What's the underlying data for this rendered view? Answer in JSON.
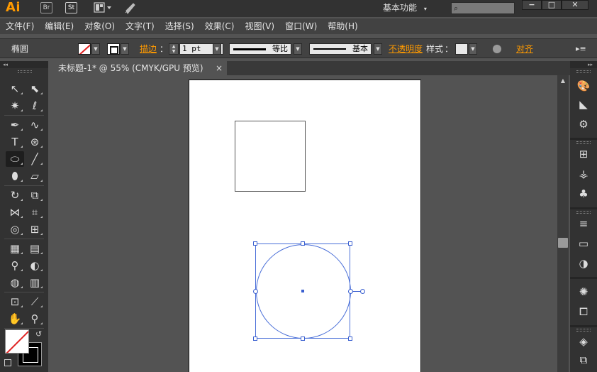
{
  "titlebar": {
    "logo": "Ai",
    "bridge_label": "Br",
    "stock_label": "St",
    "layout_icon": "layout-grid-icon",
    "sync_icon": "rocket-icon",
    "workspace": "基本功能",
    "search_placeholder": "",
    "minimize": "−",
    "maximize": "□",
    "close": "✕"
  },
  "menubar": {
    "items": [
      {
        "label": "文件(F)"
      },
      {
        "label": "编辑(E)"
      },
      {
        "label": "对象(O)"
      },
      {
        "label": "文字(T)"
      },
      {
        "label": "选择(S)"
      },
      {
        "label": "效果(C)"
      },
      {
        "label": "视图(V)"
      },
      {
        "label": "窗口(W)"
      },
      {
        "label": "帮助(H)"
      }
    ]
  },
  "controlbar": {
    "tool_name": "椭圆",
    "stroke_label": "描边",
    "stroke_weight": "1 pt",
    "profile_label": "等比",
    "brush_label": "基本",
    "opacity_label": "不透明度",
    "style_label": "样式",
    "align_label": "对齐",
    "colon": "："
  },
  "document": {
    "tab_title": "未标题-1* @ 55% (CMYK/GPU 预览)",
    "tab_close": "×"
  },
  "colors": {
    "accent_orange": "#ff9a00",
    "selection_blue": "#3a5fd0",
    "none_red": "#e02020"
  }
}
